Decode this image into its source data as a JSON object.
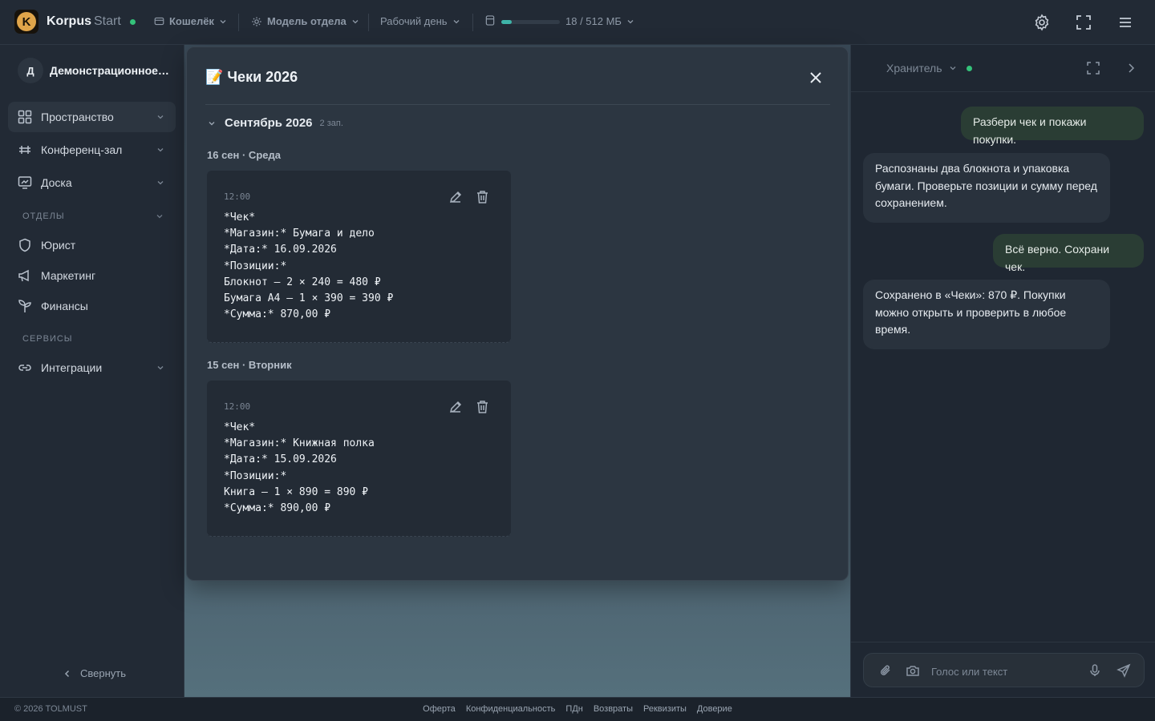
{
  "app": {
    "logo_letter": "K",
    "name": "Korpus",
    "plan": "Start",
    "status_color": "#34c27a"
  },
  "topbar": {
    "wallet_label": "Кошелёк",
    "model_label": "Модель отдела",
    "schedule_label": "Рабочий день",
    "storage_label": "18 / 512 МБ",
    "storage_used_fraction": 0.035,
    "icons": [
      "settings-icon",
      "fullscreen-icon",
      "menu-icon"
    ]
  },
  "sidebar": {
    "workspace_initial": "Д",
    "workspace_name": "Демонстрационное пространство",
    "nav": [
      {
        "label": "Пространство",
        "icon": "grid-icon",
        "active": true
      },
      {
        "label": "Конференц-зал",
        "icon": "table-icon"
      },
      {
        "label": "Доска",
        "icon": "board-icon"
      }
    ],
    "departments_label": "ОТДЕЛЫ",
    "departments": [
      {
        "label": "Юрист",
        "icon": "shield-icon"
      },
      {
        "label": "Маркетинг",
        "icon": "megaphone-icon"
      },
      {
        "label": "Финансы",
        "icon": "sprout-icon"
      }
    ],
    "services_label": "СЕРВИСЫ",
    "services": [
      {
        "label": "Интеграции",
        "icon": "link-icon"
      }
    ],
    "collapse_label": "Свернуть"
  },
  "modal": {
    "title": "📝 Чеки 2026",
    "month": "Сентябрь 2026",
    "month_count": "2 зап.",
    "entries": [
      {
        "day": "16 сен · Среда",
        "time": "12:00",
        "body": "*Чек*\n*Магазин:* Бумага и дело\n*Дата:* 16.09.2026\n*Позиции:*\nБлокнот — 2 × 240 = 480 ₽\nБумага A4 — 1 × 390 = 390 ₽\n*Сумма:* 870,00 ₽"
      },
      {
        "day": "15 сен · Вторник",
        "time": "12:00",
        "body": "*Чек*\n*Магазин:* Книжная полка\n*Дата:* 15.09.2026\n*Позиции:*\nКнига — 1 × 890 = 890 ₽\n*Сумма:* 890,00 ₽"
      }
    ]
  },
  "chat": {
    "agent_name": "Хранитель",
    "messages": [
      {
        "role": "user",
        "text": "Разбери чек и покажи покупки."
      },
      {
        "role": "bot",
        "text": "Распознаны два блокнота и упаковка бумаги. Проверьте позиции и сумму перед сохранением."
      },
      {
        "role": "user",
        "text": "Всё верно. Сохрани чек."
      },
      {
        "role": "bot",
        "text": "Сохранено в «Чеки»: 870 ₽. Покупки можно открыть и проверить в любое время."
      }
    ],
    "input_placeholder": "Голос или текст"
  },
  "footer": {
    "copyright": "© 2026 TOLMUST",
    "links": [
      "Оферта",
      "Конфиденциальность",
      "ПДн",
      "Возвраты",
      "Реквизиты",
      "Доверие"
    ]
  }
}
